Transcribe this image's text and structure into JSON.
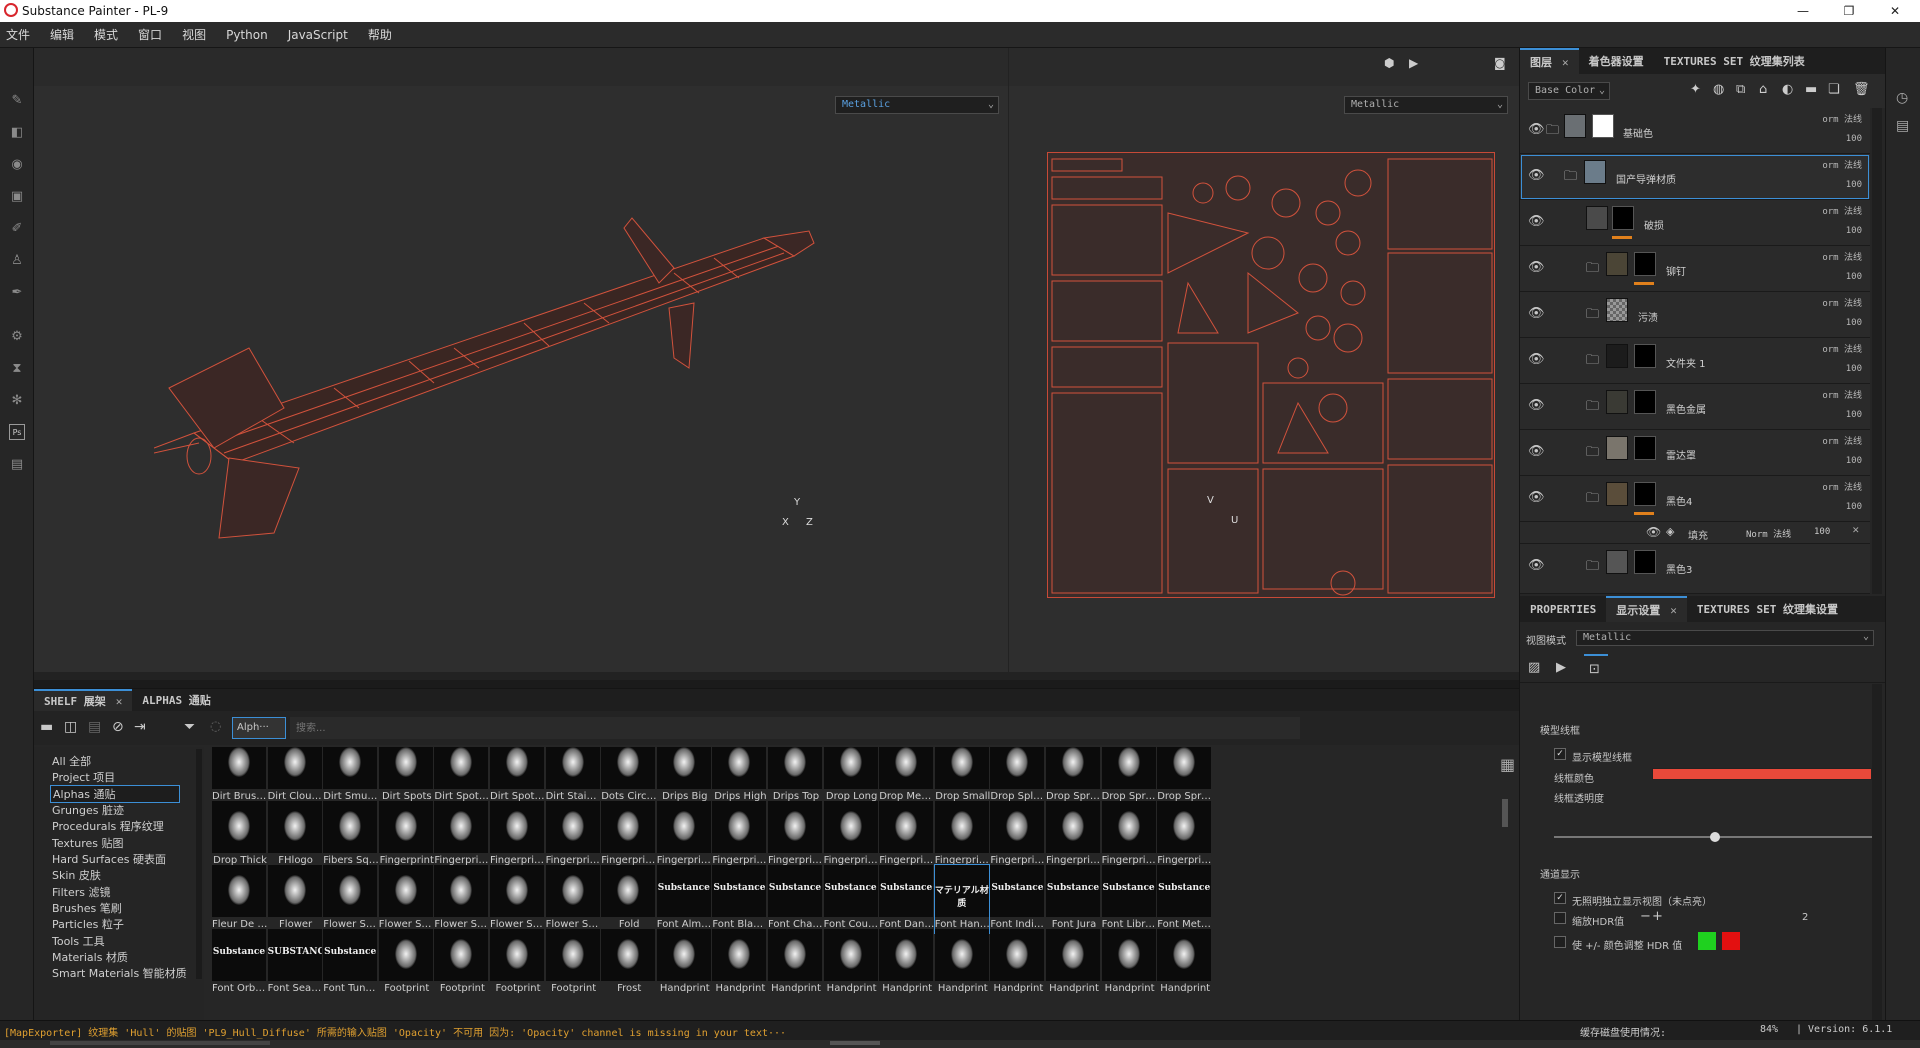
{
  "window": {
    "title": "Substance Painter - PL-9",
    "minimize": "—",
    "maximize": "❐",
    "close": "✕"
  },
  "menu": [
    "文件",
    "编辑",
    "模式",
    "窗口",
    "视图",
    "Python",
    "JavaScript",
    "帮助"
  ],
  "viewport": {
    "channel_3d": "Metallic",
    "channel_2d": "Metallic",
    "axis_x": "X",
    "axis_y": "Y",
    "axis_z": "Z",
    "uv_v": "V",
    "uv_u": "U"
  },
  "layers_panel": {
    "tabs": [
      "图层",
      "着色器设置",
      "TEXTURES SET 纹理集列表"
    ],
    "channel": "Base Color",
    "layers": [
      {
        "name": "基础色",
        "blend": "orm 法线",
        "opacity": "100"
      },
      {
        "name": "国产导弹材质",
        "blend": "orm 法线",
        "opacity": "100"
      },
      {
        "name": "破损",
        "blend": "orm 法线",
        "opacity": "100"
      },
      {
        "name": "铆钉",
        "blend": "orm 法线",
        "opacity": "100"
      },
      {
        "name": "污渍",
        "blend": "orm 法线",
        "opacity": "100"
      },
      {
        "name": "文件夹 1",
        "blend": "orm 法线",
        "opacity": "100"
      },
      {
        "name": "黑色金属",
        "blend": "orm 法线",
        "opacity": "100"
      },
      {
        "name": "雷达罩",
        "blend": "orm 法线",
        "opacity": "100"
      },
      {
        "name": "黑色4",
        "blend": "orm 法线",
        "opacity": "100"
      },
      {
        "name": "黑色3",
        "blend": "",
        "opacity": ""
      }
    ],
    "fill_row": {
      "name": "填充",
      "blend": "Norm 法线",
      "opacity": "100"
    }
  },
  "properties": {
    "tabs": [
      "PROPERTIES",
      "显示设置",
      "TEXTURES SET 纹理集设置"
    ],
    "view_mode_label": "视图模式",
    "view_mode": "Metallic",
    "section_wire": "模型线框",
    "show_wire": "显示模型线框",
    "wire_color": "线框颜色",
    "wire_opacity": "线框透明度",
    "wire_color_hex": "#e8493a",
    "section_channel": "通道显示",
    "isolate": "无照明独立显示视图（未点亮）",
    "hdr_scale": "缩放HDR值",
    "hdr_value": "2",
    "hdr_adjust": "使 +/- 颜色调整 HDR 值",
    "hdr_plus_color": "#1fd11f",
    "hdr_minus_color": "#e31010"
  },
  "shelf": {
    "tabs": [
      "SHELF 展架",
      "ALPHAS 通贴"
    ],
    "filter_tag": "Alph···",
    "search_placeholder": "搜索...",
    "categories": [
      "All 全部",
      "Project 项目",
      "Alphas 通贴",
      "Grunges 脏迹",
      "Procedurals 程序纹理",
      "Textures 贴图",
      "Hard Surfaces 硬表面",
      "Skin 皮肤",
      "Filters 滤镜",
      "Brushes 笔刷",
      "Particles 粒子",
      "Tools 工具",
      "Materials 材质",
      "Smart Materials 智能材质"
    ],
    "row1": [
      "Dirt Brush...",
      "Dirt Cloudy",
      "Dirt Smud...",
      "Dirt Spots",
      "Dirt Spots...",
      "Dirt Spots...",
      "Dirt Stain ...",
      "Dots Circu...",
      "Drips Big",
      "Drips High",
      "Drips Top",
      "Drop Long",
      "Drop Med...",
      "Drop Small",
      "Drop Spla...",
      "Drop Spre...",
      "Drop Spre...",
      "Drop Spre..."
    ],
    "row2": [
      "Drop Thick",
      "FHlogo",
      "Fibers Squ...",
      "Fingerprint",
      "Fingerprin...",
      "Fingerprin...",
      "Fingerprin...",
      "Fingerprin...",
      "Fingerprin...",
      "Fingerprin...",
      "Fingerprin...",
      "Fingerprin...",
      "Fingerprin...",
      "Fingerprin...",
      "Fingerprin...",
      "Fingerprin...",
      "Fingerprin...",
      "Fingerprin..."
    ],
    "row3": [
      "Fleur De Lis",
      "Flower",
      "Flower Sa...",
      "Flower Sa...",
      "Flower Sa...",
      "Flower Sa...",
      "Flower Sty...",
      "Fold",
      "Font Alme...",
      "Font Black...",
      "Font Chat...",
      "Font Couri...",
      "Font Danc...",
      "Font Han ...",
      "Font Indie ...",
      "Font Jura",
      "Font Libre ...",
      "Font Meta..."
    ],
    "row3_text": [
      "",
      "",
      "",
      "",
      "",
      "",
      "",
      "",
      "Substance",
      "Substance",
      "Substance",
      "Substance",
      "Substance",
      "マテリアル材质",
      "Substance",
      "Substance",
      "Substance",
      "Substance"
    ],
    "row4": [
      "Font Orbit...",
      "Font Seam...",
      "Font Tuna...",
      "Footprint",
      "Footprint",
      "Footprint",
      "Footprint",
      "Frost",
      "Handprint",
      "Handprint",
      "Handprint",
      "Handprint",
      "Handprint",
      "Handprint",
      "Handprint",
      "Handprint",
      "Handprint",
      "Handprint"
    ],
    "row4_text": [
      "Substance",
      "SUBSTANCE",
      "Substance",
      "",
      "",
      "",
      "",
      "",
      "",
      "",
      "",
      "",
      "",
      "",
      "",
      "",
      "",
      ""
    ]
  },
  "status": {
    "message": "[MapExporter] 纹理集 'Hull' 的贴图 'PL9_Hull_Diffuse' 所需的输入贴图 'Opacity' 不可用 因为: 'Opacity' channel is missing in your text···",
    "cache": "缓存磁盘使用情况:",
    "cache_value": "84%",
    "version": "| Version: 6.1.1"
  }
}
